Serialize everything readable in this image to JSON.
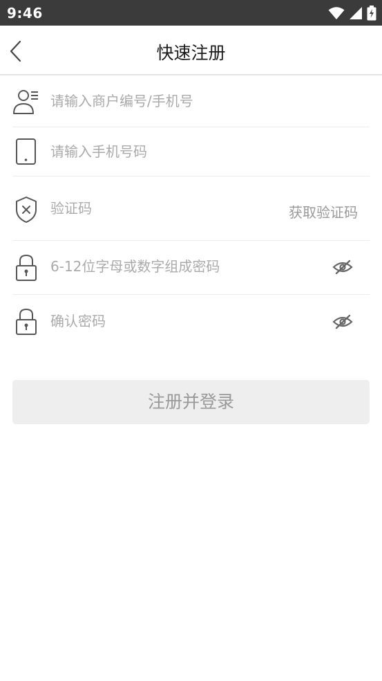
{
  "status_bar": {
    "time": "9:46",
    "icons": [
      "wifi-icon",
      "signal-icon",
      "battery-icon"
    ]
  },
  "header": {
    "back_icon": "chevron-left-icon",
    "title": "快速注册"
  },
  "form": {
    "merchant": {
      "icon": "user-card-icon",
      "placeholder": "请输入商户编号/手机号",
      "value": ""
    },
    "phone": {
      "icon": "phone-icon",
      "placeholder": "请输入手机号码",
      "value": ""
    },
    "code": {
      "icon": "shield-x-icon",
      "placeholder": "验证码",
      "value": "",
      "get_code_label": "获取验证码"
    },
    "password": {
      "icon": "lock-icon",
      "placeholder": "6-12位字母或数字组成密码",
      "value": "",
      "toggle_icon": "eye-off-icon"
    },
    "confirm_password": {
      "icon": "lock-icon",
      "placeholder": "确认密码",
      "value": "",
      "toggle_icon": "eye-off-icon"
    }
  },
  "submit": {
    "label": "注册并登录"
  },
  "colors": {
    "status_bar_bg": "#3b3b3b",
    "placeholder": "#aaaaaa",
    "button_bg": "#eeeeee",
    "button_text": "#999999",
    "divider": "#ececec"
  }
}
